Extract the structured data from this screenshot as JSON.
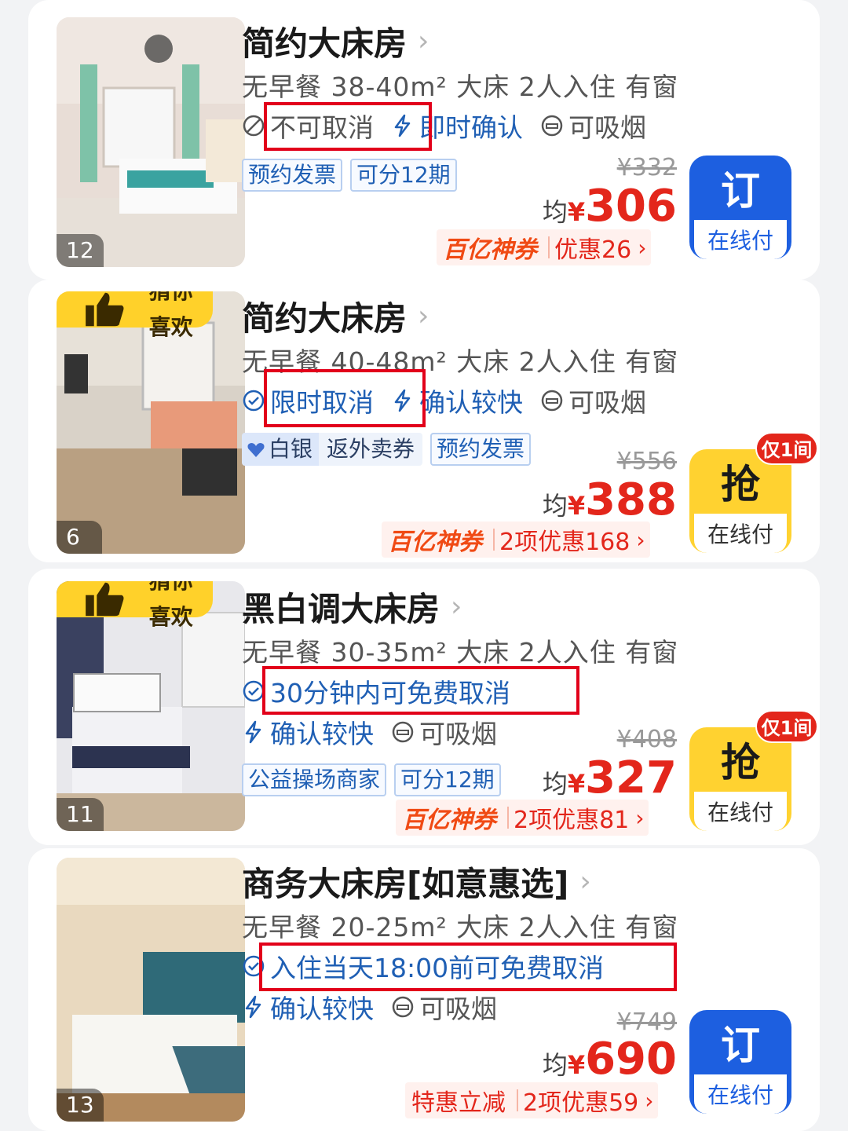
{
  "rooms": [
    {
      "title": "简约大床房",
      "desc": "无早餐 38-40m² 大床 2人入住 有窗",
      "cancel": "不可取消",
      "confirm": "即时确认",
      "smoke": "可吸烟",
      "tags": [
        "预约发票",
        "可分12期"
      ],
      "orig_price": "¥332",
      "avg_label": "均",
      "yen": "¥",
      "price": "306",
      "promo_brand": "百亿神券",
      "promo_text": "优惠26",
      "book_top": "订",
      "book_bottom": "在线付",
      "photo_count": "12"
    },
    {
      "title": "简约大床房",
      "desc": "无早餐 40-48m² 大床 2人入住 有窗",
      "cancel": "限时取消",
      "confirm": "确认较快",
      "smoke": "可吸烟",
      "member_level": "白银",
      "member_benefit": "返外卖券",
      "tags": [
        "预约发票"
      ],
      "orig_price": "¥556",
      "avg_label": "均",
      "yen": "¥",
      "price": "388",
      "promo_brand": "百亿神券",
      "promo_text": "2项优惠168",
      "book_top": "抢",
      "book_bottom": "在线付",
      "only_badge": "仅1间",
      "guess_badge": "猜你喜欢",
      "photo_count": "6"
    },
    {
      "title": "黑白调大床房",
      "desc": "无早餐 30-35m² 大床 2人入住 有窗",
      "cancel": "30分钟内可免费取消",
      "confirm": "确认较快",
      "smoke": "可吸烟",
      "tags": [
        "公益操场商家",
        "可分12期"
      ],
      "orig_price": "¥408",
      "avg_label": "均",
      "yen": "¥",
      "price": "327",
      "promo_brand": "百亿神券",
      "promo_text": "2项优惠81",
      "book_top": "抢",
      "book_bottom": "在线付",
      "only_badge": "仅1间",
      "guess_badge": "猜你喜欢",
      "photo_count": "11"
    },
    {
      "title": "商务大床房[如意惠选]",
      "desc": "无早餐 20-25m² 大床 2人入住 有窗",
      "cancel": "入住当天18:00前可免费取消",
      "confirm": "确认较快",
      "smoke": "可吸烟",
      "orig_price": "¥749",
      "avg_label": "均",
      "yen": "¥",
      "price": "690",
      "promo_brand": "特惠立减",
      "promo_text": "2项优惠59",
      "book_top": "订",
      "book_bottom": "在线付",
      "photo_count": "13"
    }
  ],
  "colors": {
    "accent_blue": "#1d5fe0",
    "price_red": "#e3261b",
    "highlight_red": "#e2001a",
    "badge_yellow": "#ffd230"
  }
}
